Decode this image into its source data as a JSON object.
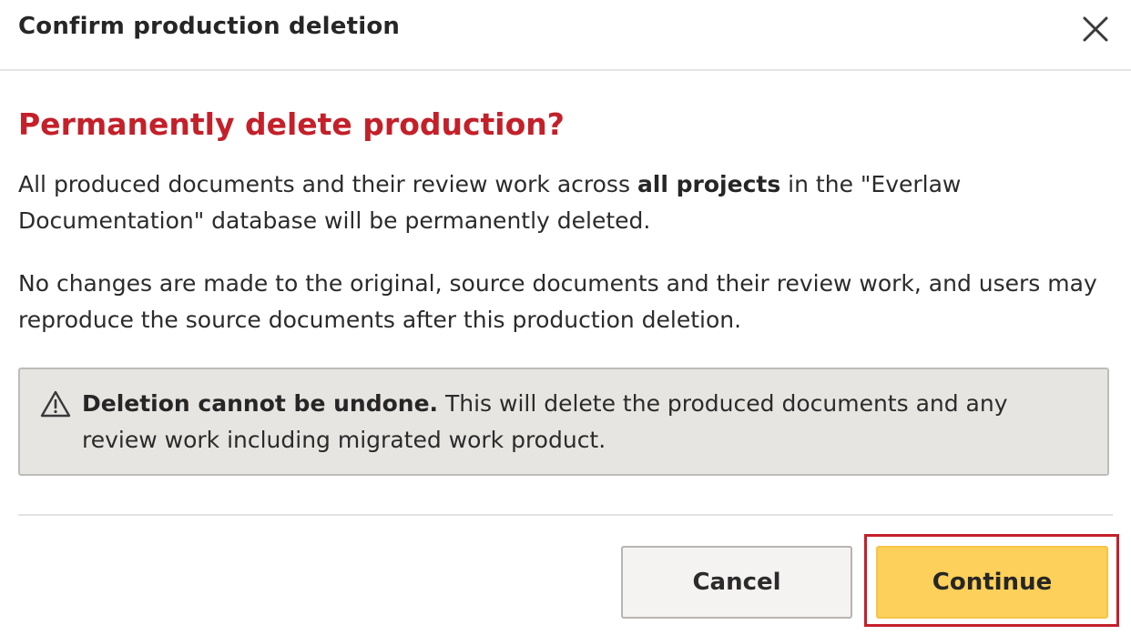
{
  "dialog": {
    "title": "Confirm production deletion",
    "close_icon": "close-icon"
  },
  "content": {
    "heading": "Permanently delete production?",
    "paragraph1": {
      "before": "All produced documents and their review work across ",
      "bold": "all projects",
      "after": " in the \"Everlaw Documentation\" database will be permanently deleted."
    },
    "paragraph2": "No changes are made to the original, source documents and their review work, and users may reproduce the source documents after this production deletion."
  },
  "warning": {
    "icon": "warning-triangle-icon",
    "bold": "Deletion cannot be undone.",
    "text": " This will delete the produced documents and any review work including migrated work product."
  },
  "buttons": {
    "cancel_label": "Cancel",
    "continue_label": "Continue"
  },
  "colors": {
    "danger": "#c4202a",
    "primary_button": "#fcd05a",
    "warning_bg": "#e6e5e2",
    "highlight_border": "#c4202a"
  }
}
